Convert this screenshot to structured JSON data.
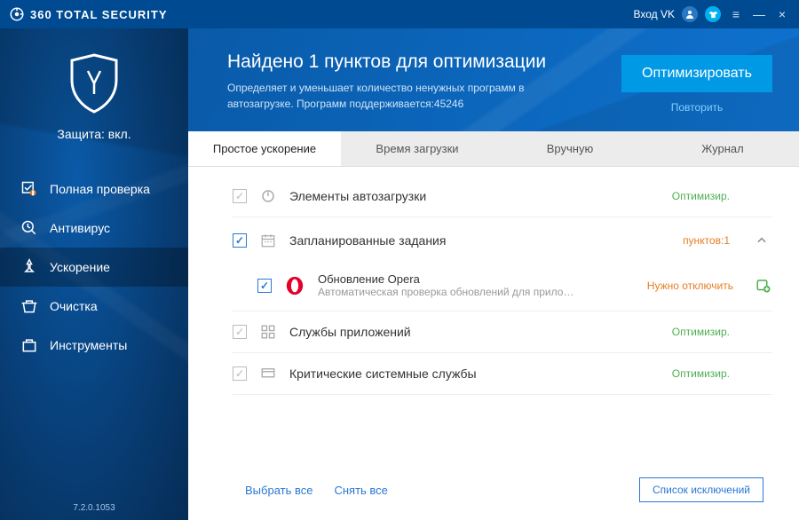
{
  "titlebar": {
    "brand": "360 TOTAL SECURITY",
    "login": "Вход VK"
  },
  "sidebar": {
    "shield_status": "Защита: вкл.",
    "items": [
      {
        "label": "Полная проверка"
      },
      {
        "label": "Антивирус"
      },
      {
        "label": "Ускорение"
      },
      {
        "label": "Очистка"
      },
      {
        "label": "Инструменты"
      }
    ],
    "version": "7.2.0.1053"
  },
  "header": {
    "title": "Найдено 1 пунктов для оптимизации",
    "desc": "Определяет и уменьшает количество ненужных программ в автозагрузке. Программ поддерживается:45246",
    "optimize": "Оптимизировать",
    "retry": "Повторить"
  },
  "tabs": [
    "Простое ускорение",
    "Время загрузки",
    "Вручную",
    "Журнал"
  ],
  "sections": {
    "startup": {
      "title": "Элементы автозагрузки",
      "status": "Оптимизир."
    },
    "scheduled": {
      "title": "Запланированные задания",
      "status": "пунктов:1",
      "child": {
        "title": "Обновление Opera",
        "sub": "Автоматическая проверка обновлений для прило…",
        "status": "Нужно отключить"
      }
    },
    "services": {
      "title": "Службы приложений",
      "status": "Оптимизир."
    },
    "critical": {
      "title": "Критические системные службы",
      "status": "Оптимизир."
    }
  },
  "footer": {
    "select_all": "Выбрать все",
    "deselect_all": "Снять все",
    "exclusions": "Список исключений"
  }
}
